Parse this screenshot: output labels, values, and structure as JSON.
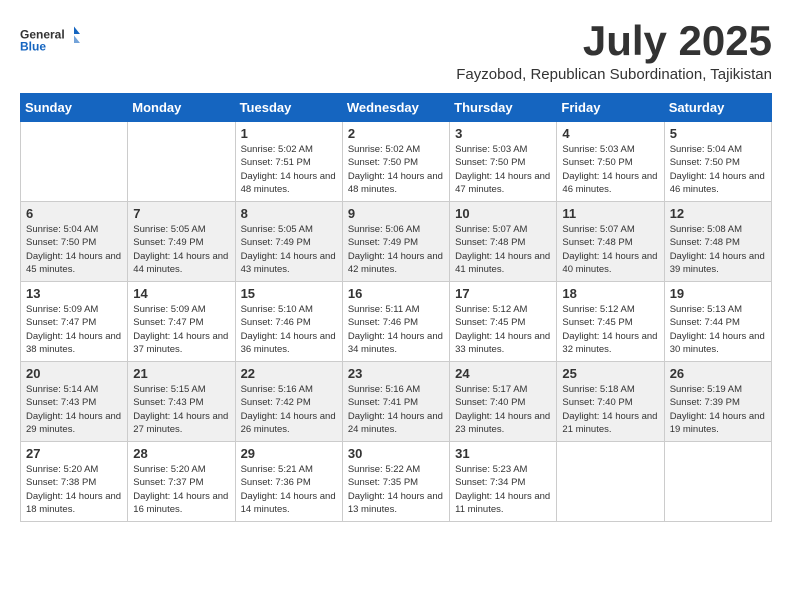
{
  "logo": {
    "general": "General",
    "blue": "Blue"
  },
  "title": "July 2025",
  "subtitle": "Fayzobod, Republican Subordination, Tajikistan",
  "days_header": [
    "Sunday",
    "Monday",
    "Tuesday",
    "Wednesday",
    "Thursday",
    "Friday",
    "Saturday"
  ],
  "weeks": [
    [
      {
        "day": "",
        "info": ""
      },
      {
        "day": "",
        "info": ""
      },
      {
        "day": "1",
        "info": "Sunrise: 5:02 AM\nSunset: 7:51 PM\nDaylight: 14 hours and 48 minutes."
      },
      {
        "day": "2",
        "info": "Sunrise: 5:02 AM\nSunset: 7:50 PM\nDaylight: 14 hours and 48 minutes."
      },
      {
        "day": "3",
        "info": "Sunrise: 5:03 AM\nSunset: 7:50 PM\nDaylight: 14 hours and 47 minutes."
      },
      {
        "day": "4",
        "info": "Sunrise: 5:03 AM\nSunset: 7:50 PM\nDaylight: 14 hours and 46 minutes."
      },
      {
        "day": "5",
        "info": "Sunrise: 5:04 AM\nSunset: 7:50 PM\nDaylight: 14 hours and 46 minutes."
      }
    ],
    [
      {
        "day": "6",
        "info": "Sunrise: 5:04 AM\nSunset: 7:50 PM\nDaylight: 14 hours and 45 minutes."
      },
      {
        "day": "7",
        "info": "Sunrise: 5:05 AM\nSunset: 7:49 PM\nDaylight: 14 hours and 44 minutes."
      },
      {
        "day": "8",
        "info": "Sunrise: 5:05 AM\nSunset: 7:49 PM\nDaylight: 14 hours and 43 minutes."
      },
      {
        "day": "9",
        "info": "Sunrise: 5:06 AM\nSunset: 7:49 PM\nDaylight: 14 hours and 42 minutes."
      },
      {
        "day": "10",
        "info": "Sunrise: 5:07 AM\nSunset: 7:48 PM\nDaylight: 14 hours and 41 minutes."
      },
      {
        "day": "11",
        "info": "Sunrise: 5:07 AM\nSunset: 7:48 PM\nDaylight: 14 hours and 40 minutes."
      },
      {
        "day": "12",
        "info": "Sunrise: 5:08 AM\nSunset: 7:48 PM\nDaylight: 14 hours and 39 minutes."
      }
    ],
    [
      {
        "day": "13",
        "info": "Sunrise: 5:09 AM\nSunset: 7:47 PM\nDaylight: 14 hours and 38 minutes."
      },
      {
        "day": "14",
        "info": "Sunrise: 5:09 AM\nSunset: 7:47 PM\nDaylight: 14 hours and 37 minutes."
      },
      {
        "day": "15",
        "info": "Sunrise: 5:10 AM\nSunset: 7:46 PM\nDaylight: 14 hours and 36 minutes."
      },
      {
        "day": "16",
        "info": "Sunrise: 5:11 AM\nSunset: 7:46 PM\nDaylight: 14 hours and 34 minutes."
      },
      {
        "day": "17",
        "info": "Sunrise: 5:12 AM\nSunset: 7:45 PM\nDaylight: 14 hours and 33 minutes."
      },
      {
        "day": "18",
        "info": "Sunrise: 5:12 AM\nSunset: 7:45 PM\nDaylight: 14 hours and 32 minutes."
      },
      {
        "day": "19",
        "info": "Sunrise: 5:13 AM\nSunset: 7:44 PM\nDaylight: 14 hours and 30 minutes."
      }
    ],
    [
      {
        "day": "20",
        "info": "Sunrise: 5:14 AM\nSunset: 7:43 PM\nDaylight: 14 hours and 29 minutes."
      },
      {
        "day": "21",
        "info": "Sunrise: 5:15 AM\nSunset: 7:43 PM\nDaylight: 14 hours and 27 minutes."
      },
      {
        "day": "22",
        "info": "Sunrise: 5:16 AM\nSunset: 7:42 PM\nDaylight: 14 hours and 26 minutes."
      },
      {
        "day": "23",
        "info": "Sunrise: 5:16 AM\nSunset: 7:41 PM\nDaylight: 14 hours and 24 minutes."
      },
      {
        "day": "24",
        "info": "Sunrise: 5:17 AM\nSunset: 7:40 PM\nDaylight: 14 hours and 23 minutes."
      },
      {
        "day": "25",
        "info": "Sunrise: 5:18 AM\nSunset: 7:40 PM\nDaylight: 14 hours and 21 minutes."
      },
      {
        "day": "26",
        "info": "Sunrise: 5:19 AM\nSunset: 7:39 PM\nDaylight: 14 hours and 19 minutes."
      }
    ],
    [
      {
        "day": "27",
        "info": "Sunrise: 5:20 AM\nSunset: 7:38 PM\nDaylight: 14 hours and 18 minutes."
      },
      {
        "day": "28",
        "info": "Sunrise: 5:20 AM\nSunset: 7:37 PM\nDaylight: 14 hours and 16 minutes."
      },
      {
        "day": "29",
        "info": "Sunrise: 5:21 AM\nSunset: 7:36 PM\nDaylight: 14 hours and 14 minutes."
      },
      {
        "day": "30",
        "info": "Sunrise: 5:22 AM\nSunset: 7:35 PM\nDaylight: 14 hours and 13 minutes."
      },
      {
        "day": "31",
        "info": "Sunrise: 5:23 AM\nSunset: 7:34 PM\nDaylight: 14 hours and 11 minutes."
      },
      {
        "day": "",
        "info": ""
      },
      {
        "day": "",
        "info": ""
      }
    ]
  ]
}
